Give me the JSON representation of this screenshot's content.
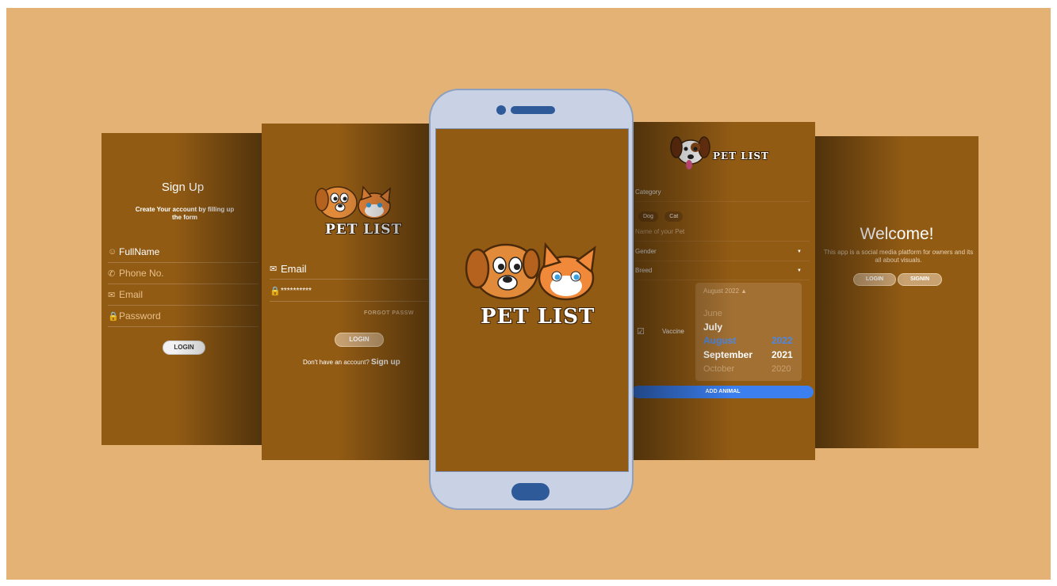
{
  "signup": {
    "title": "Sign Up",
    "subtitle": "Create Your account by filling up the form",
    "fields": [
      {
        "label": "FullName"
      },
      {
        "label": "Phone No."
      },
      {
        "label": "Email"
      },
      {
        "label": "Password"
      }
    ],
    "login_button": "LOGIN"
  },
  "login": {
    "logo_text": "PET LIST",
    "email_label": "Email",
    "password_value": "**********",
    "forgot_password": "FORGOT PASSW",
    "login_button": "LOGIN",
    "no_account_text": "Don't have an account?",
    "signup_link": "Sign up"
  },
  "splash": {
    "logo_text": "PET LIST"
  },
  "add_animal": {
    "logo_text": "PET LIST",
    "category_label": "Category",
    "chips": [
      "Dog",
      "Cat"
    ],
    "pet_name_placeholder": "Name of your Pet",
    "gender_label": "Gender",
    "breed_label": "Breed",
    "vaccine_label": "Vaccine",
    "picker": {
      "header": "August 2022 ▲",
      "months": [
        "June",
        "July",
        "August",
        "September",
        "October"
      ],
      "years": [
        "2022",
        "2021",
        "2020"
      ]
    },
    "add_button": "ADD ANIMAL"
  },
  "welcome": {
    "title": "Welcome!",
    "description": "This app is a social media platform for owners and its all about visuals.",
    "login_button": "LOGIN",
    "signin_button": "SIGNIN"
  },
  "colors": {
    "background": "#e4b274",
    "screen": "#925b14",
    "phone_body": "#c8d2e4",
    "phone_accent": "#2e5a9a",
    "add_button": "#3b7ff0"
  }
}
